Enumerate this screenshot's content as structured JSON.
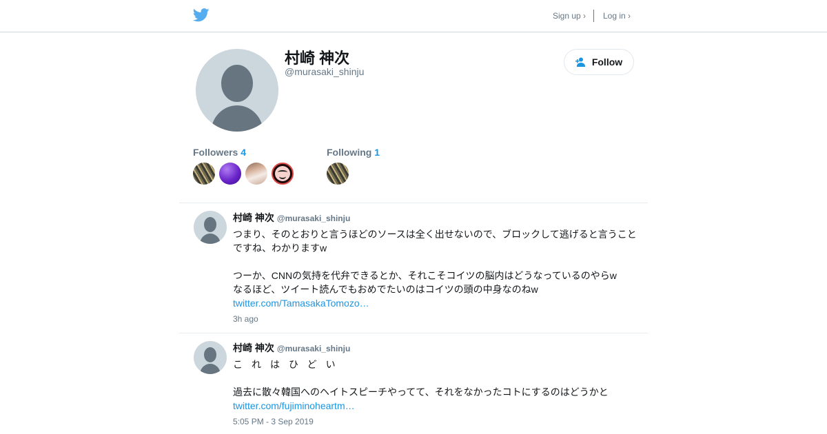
{
  "header": {
    "signup_label": "Sign up ›",
    "login_label": "Log in ›"
  },
  "profile": {
    "display_name": "村崎 神次",
    "screen_name": "@murasaki_shinju",
    "follow_label": "Follow",
    "followers_label": "Followers",
    "followers_count": "4",
    "following_label": "Following",
    "following_count": "1"
  },
  "tweets": [
    {
      "name": "村崎 神次",
      "handle": "@murasaki_shinju",
      "line1": "つまり、そのとおりと言うほどのソースは全く出せないので、ブロックして逃げると言うこと",
      "line2": "ですね、わかりますw",
      "line3": "つーか、CNNの気持を代弁できるとか、それこそコイツの脳内はどうなっているのやらw",
      "line4": "なるほど、ツイート読んでもおめでたいのはコイツの頭の中身なのねw",
      "link": "twitter.com/TamasakaTomozo…",
      "time": "3h ago"
    },
    {
      "name": "村崎 神次",
      "handle": "@murasaki_shinju",
      "line1": "これはひどい",
      "line2": "過去に散々韓国へのヘイトスピーチやってて、それをなかったコトにするのはどうかと",
      "link": "twitter.com/fujiminoheartm…",
      "time": "5:05 PM - 3 Sep 2019"
    }
  ],
  "colors": {
    "accent": "#1b95e0",
    "bird": "#55acee",
    "avatar_bg": "#ccd6dd",
    "avatar_fg": "#66757f"
  }
}
